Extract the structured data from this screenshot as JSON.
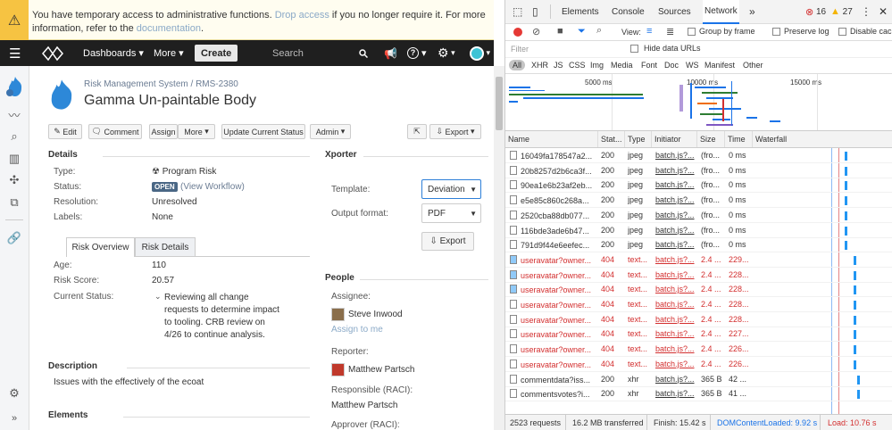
{
  "banner": {
    "text_before": "You have temporary access to administrative functions. ",
    "drop_link": "Drop access",
    "text_mid": " if you no longer require it. For more information, refer to the ",
    "doc_link": "documentation",
    "text_after": "."
  },
  "topbar": {
    "dashboards": "Dashboards",
    "more": "More",
    "create": "Create",
    "search": "Search"
  },
  "issue": {
    "breadcrumb_project": "Risk Management System",
    "breadcrumb_sep": "/",
    "breadcrumb_key": "RMS-2380",
    "title": "Gamma Un-paintable Body"
  },
  "toolbar": {
    "edit": "Edit",
    "comment": "Comment",
    "assign": "Assign",
    "more": "More",
    "update_status": "Update Current Status",
    "admin": "Admin",
    "export": "Export"
  },
  "details": {
    "heading": "Details",
    "type_label": "Type:",
    "type_value": "Program Risk",
    "status_label": "Status:",
    "status_badge": "OPEN",
    "view_workflow": "(View Workflow)",
    "resolution_label": "Resolution:",
    "resolution_value": "Unresolved",
    "labels_label": "Labels:",
    "labels_value": "None"
  },
  "tabs": {
    "overview": "Risk Overview",
    "details": "Risk Details"
  },
  "overview": {
    "age_label": "Age:",
    "age_value": "110",
    "score_label": "Risk Score:",
    "score_value": "20.57",
    "current_label": "Current Status:",
    "current_value": [
      "Reviewing all change",
      "requests to determine impact",
      "to tooling.  CRB review on",
      "4/26 to continue analysis."
    ]
  },
  "description": {
    "heading": "Description",
    "text": "Issues with the effectively of the ecoat"
  },
  "elements": {
    "heading": "Elements"
  },
  "xporter": {
    "heading": "Xporter",
    "template_label": "Template:",
    "template_value": "Deviation",
    "format_label": "Output format:",
    "format_value": "PDF",
    "export_button": "Export"
  },
  "people": {
    "heading": "People",
    "assignee_label": "Assignee:",
    "assignee_name": "Steve Inwood",
    "assign_to_me": "Assign to me",
    "reporter_label": "Reporter:",
    "reporter_name": "Matthew Partsch",
    "responsible_label": "Responsible (RACI):",
    "responsible_name": "Matthew Partsch",
    "approver_label": "Approver (RACI):"
  },
  "devtools": {
    "tabs": [
      "Elements",
      "Console",
      "Sources",
      "Network"
    ],
    "more_tabs": "»",
    "errors": "16",
    "warnings": "27",
    "filter_placeholder": "Filter",
    "hide_data_urls": "Hide data URLs",
    "view_label": "View:",
    "group_by_frame": "Group by frame",
    "preserve_log": "Preserve log",
    "disable_cache": "Disable cac",
    "types": [
      "All",
      "XHR",
      "JS",
      "CSS",
      "Img",
      "Media",
      "Font",
      "Doc",
      "WS",
      "Manifest",
      "Other"
    ],
    "timeline_ticks": [
      "5000 ms",
      "10000 ms",
      "15000 ms"
    ],
    "columns": [
      "Name",
      "Stat...",
      "Type",
      "Initiator",
      "Size",
      "Time",
      "Waterfall"
    ],
    "rows": [
      {
        "name": "16049fa178547a2...",
        "status": "200",
        "type": "jpeg",
        "initiator": "batch.js?...",
        "size": "(fro...",
        "time": "0 ms",
        "err": false,
        "icon": "file"
      },
      {
        "name": "20b8257d2b6ca3f...",
        "status": "200",
        "type": "jpeg",
        "initiator": "batch.js?...",
        "size": "(fro...",
        "time": "0 ms",
        "err": false,
        "icon": "file"
      },
      {
        "name": "90ea1e6b23af2eb...",
        "status": "200",
        "type": "jpeg",
        "initiator": "batch.js?...",
        "size": "(fro...",
        "time": "0 ms",
        "err": false,
        "icon": "file"
      },
      {
        "name": "e5e85c860c268a...",
        "status": "200",
        "type": "jpeg",
        "initiator": "batch.js?...",
        "size": "(fro...",
        "time": "0 ms",
        "err": false,
        "icon": "file"
      },
      {
        "name": "2520cba88db077...",
        "status": "200",
        "type": "jpeg",
        "initiator": "batch.js?...",
        "size": "(fro...",
        "time": "0 ms",
        "err": false,
        "icon": "file"
      },
      {
        "name": "116bde3ade6b47...",
        "status": "200",
        "type": "jpeg",
        "initiator": "batch.js?...",
        "size": "(fro...",
        "time": "0 ms",
        "err": false,
        "icon": "file"
      },
      {
        "name": "791d9f44e6eefec...",
        "status": "200",
        "type": "jpeg",
        "initiator": "batch.js?...",
        "size": "(fro...",
        "time": "0 ms",
        "err": false,
        "icon": "file"
      },
      {
        "name": "useravatar?owner...",
        "status": "404",
        "type": "text...",
        "initiator": "batch.js?...",
        "size": "2.4 ...",
        "time": "229...",
        "err": true,
        "icon": "img"
      },
      {
        "name": "useravatar?owner...",
        "status": "404",
        "type": "text...",
        "initiator": "batch.js?...",
        "size": "2.4 ...",
        "time": "228...",
        "err": true,
        "icon": "img"
      },
      {
        "name": "useravatar?owner...",
        "status": "404",
        "type": "text...",
        "initiator": "batch.js?...",
        "size": "2.4 ...",
        "time": "228...",
        "err": true,
        "icon": "img"
      },
      {
        "name": "useravatar?owner...",
        "status": "404",
        "type": "text...",
        "initiator": "batch.js?...",
        "size": "2.4 ...",
        "time": "228...",
        "err": true,
        "icon": "file"
      },
      {
        "name": "useravatar?owner...",
        "status": "404",
        "type": "text...",
        "initiator": "batch.js?...",
        "size": "2.4 ...",
        "time": "228...",
        "err": true,
        "icon": "file"
      },
      {
        "name": "useravatar?owner...",
        "status": "404",
        "type": "text...",
        "initiator": "batch.js?...",
        "size": "2.4 ...",
        "time": "227...",
        "err": true,
        "icon": "file"
      },
      {
        "name": "useravatar?owner...",
        "status": "404",
        "type": "text...",
        "initiator": "batch.js?...",
        "size": "2.4 ...",
        "time": "226...",
        "err": true,
        "icon": "file"
      },
      {
        "name": "useravatar?owner...",
        "status": "404",
        "type": "text...",
        "initiator": "batch.js?...",
        "size": "2.4 ...",
        "time": "226...",
        "err": true,
        "icon": "file"
      },
      {
        "name": "commentdata?iss...",
        "status": "200",
        "type": "xhr",
        "initiator": "batch.js?...",
        "size": "365 B",
        "time": "42 ...",
        "err": false,
        "icon": "file"
      },
      {
        "name": "commentsvotes?i...",
        "status": "200",
        "type": "xhr",
        "initiator": "batch.js?...",
        "size": "365 B",
        "time": "41 ...",
        "err": false,
        "icon": "file"
      }
    ],
    "footer": {
      "requests": "2523 requests",
      "transferred": "16.2 MB transferred",
      "finish": "Finish: 15.42 s",
      "dcl": "DOMContentLoaded: 9.92 s",
      "load": "Load: 10.76 s"
    }
  },
  "colors": {
    "accent": "#3b73af",
    "topbar": "#1f1f1f",
    "error": "#d32f2f",
    "warning_banner": "#f6c342",
    "status_open": "#4a6785",
    "dcl": "#1a73e8",
    "load": "#d32f2f"
  }
}
